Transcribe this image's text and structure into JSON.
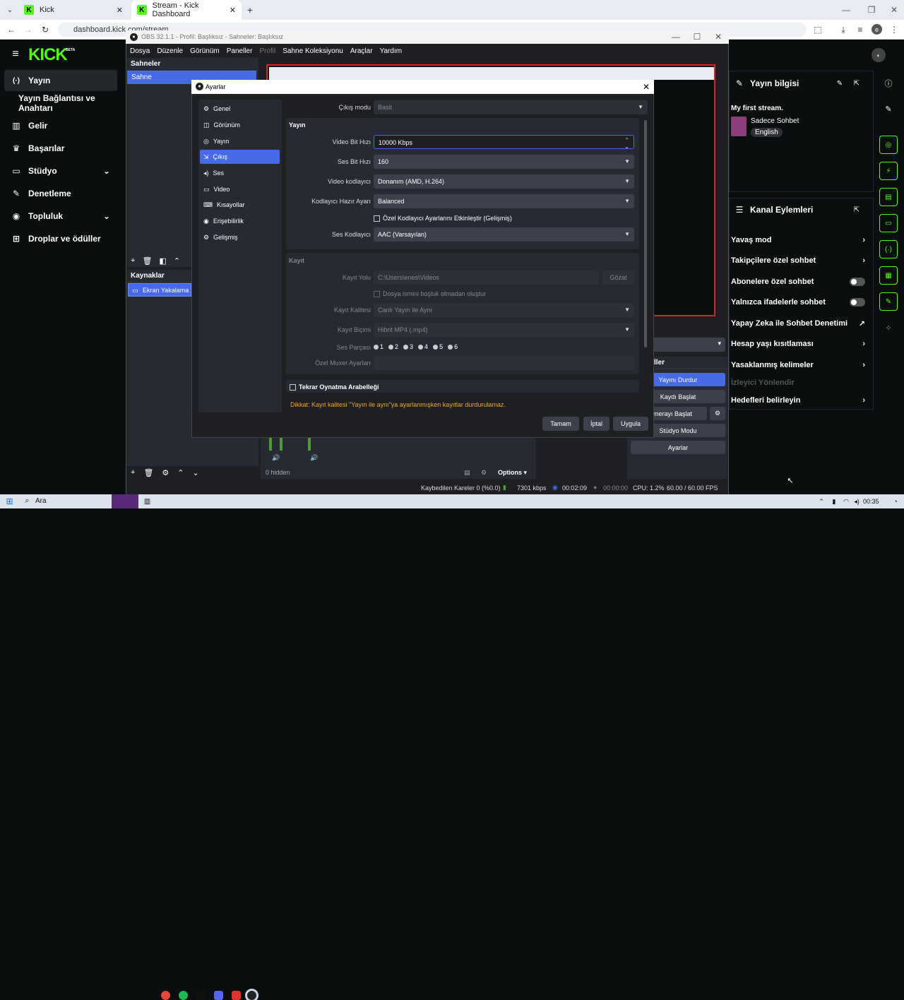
{
  "browser": {
    "tabs": [
      {
        "label": "Kick"
      },
      {
        "label": "Stream - Kick Dashboard"
      }
    ],
    "url": "dashboard.kick.com/stream",
    "profile_initial": "e"
  },
  "kick": {
    "logo": "KICK",
    "logo_badge": "BETA",
    "nav": [
      {
        "label": "Yayın",
        "icon": "broadcast-icon"
      },
      {
        "label": "Yayın Bağlantısı ve Anahtarı",
        "icon": ""
      },
      {
        "label": "Gelir",
        "icon": "chart-icon"
      },
      {
        "label": "Başarılar",
        "icon": "trophy-icon"
      },
      {
        "label": "Stüdyo",
        "icon": "studio-icon"
      },
      {
        "label": "Denetleme",
        "icon": "wrench-icon"
      },
      {
        "label": "Topluluk",
        "icon": "community-icon"
      },
      {
        "label": "Droplar ve ödüller",
        "icon": "gift-icon"
      }
    ],
    "stream_info": {
      "header": "Yayın bilgisi",
      "title": "My first stream.",
      "category": "Sadece Sohbet",
      "tag": "English"
    },
    "channel_actions": {
      "header": "Kanal Eylemleri",
      "items": [
        {
          "label": "Yavaş mod",
          "control": "chevron"
        },
        {
          "label": "Takipçilere özel sohbet",
          "control": "chevron"
        },
        {
          "label": "Abonelere özel sohbet",
          "control": "toggle"
        },
        {
          "label": "Yalnızca ifadelerle sohbet",
          "control": "toggle"
        },
        {
          "label": "Yapay Zeka ile Sohbet Denetimi",
          "control": "external"
        },
        {
          "label": "Hesap yaşı kısıtlaması",
          "control": "chevron"
        },
        {
          "label": "Yasaklanmış kelimeler",
          "control": "chevron"
        },
        {
          "label": "İzleyici Yönlendir",
          "control": "disabled"
        },
        {
          "label": "Hedefleri belirleyin",
          "control": "chevron"
        }
      ]
    }
  },
  "obs": {
    "title": "OBS 32.1.1 - Profil: Başlıksız - Sahneler: Başlıksız",
    "menu": [
      "Dosya",
      "Düzenle",
      "Görünüm",
      "Paneller",
      "Profil",
      "Sahne Koleksiyonu",
      "Araçlar",
      "Yardım"
    ],
    "scenes_header": "Sahneler",
    "scene_item": "Sahne",
    "sources_header": "Kaynaklar",
    "source_item": "Ekran Yakalama",
    "hidden_label": "0 hidden",
    "options_label": "Options",
    "controls_header": "ller",
    "controls": [
      "Yayını Durdur",
      "Kaydı Başlat",
      "Kamerayı Başlat",
      "Stüdyo Modu",
      "Ayarlar"
    ],
    "statusbar": {
      "dropped": "Kaybedilen Kareler 0 (%0.0)",
      "bitrate": "7301 kbps",
      "stream_time": "00:02:09",
      "rec_time": "00:00:00",
      "cpu": "CPU: 1.2%",
      "fps": "60.00 / 60.00 FPS"
    }
  },
  "settings": {
    "title": "Ayarlar",
    "categories": [
      "Genel",
      "Görünüm",
      "Yayın",
      "Çıkış",
      "Ses",
      "Video",
      "Kısayollar",
      "Erişebilirlik",
      "Gelişmiş"
    ],
    "selected_category": "Çıkış",
    "output_mode_label": "Çıkış modu",
    "output_mode": "Basit",
    "stream_section": "Yayın",
    "video_bitrate_label": "Video Bit Hızı",
    "video_bitrate": "10000 Kbps",
    "audio_bitrate_label": "Ses Bit Hızı",
    "audio_bitrate": "160",
    "video_encoder_label": "Video kodlayıcı",
    "video_encoder": "Donanım (AMD, H.264)",
    "encoder_preset_label": "Kodlayıcı Hazır Ayarı",
    "encoder_preset": "Balanced",
    "custom_encoder_label": "Özel Kodlayıcı Ayarlarını Etkinleştir (Gelişmiş)",
    "audio_encoder_label": "Ses Kodlayıcı",
    "audio_encoder": "AAC (Varsayılan)",
    "record_section": "Kayıt",
    "record_path_label": "Kayıt Yolu",
    "record_path": "C:\\Users\\enes\\Videos",
    "browse_label": "Gözat",
    "no_space_label": "Dosya ismini boşluk olmadan oluştur",
    "record_quality_label": "Kayıt Kalitesi",
    "record_quality": "Canlı Yayın ile Aynı",
    "record_format_label": "Kayıt Biçimi",
    "record_format": "Hibrit MP4 (.mp4)",
    "audio_tracks_label": "Ses Parçası",
    "audio_tracks": [
      "1",
      "2",
      "3",
      "4",
      "5",
      "6"
    ],
    "muxer_label": "Özel Muxer Ayarları",
    "replay_buffer_label": "Tekrar Oynatma Arabelleği",
    "warning": "Dikkat: Kayıt kalitesi \"Yayın ile aynı\"ya ayarlanmışken kayıtlar durdurulamaz.",
    "ok_label": "Tamam",
    "cancel_label": "İptal",
    "apply_label": "Uygula"
  },
  "taskbar": {
    "search_label": "Ara",
    "time": "00:35"
  },
  "colors": {
    "kick_green": "#53fc18",
    "obs_accent": "#476be6",
    "warning": "#e6a93c"
  }
}
